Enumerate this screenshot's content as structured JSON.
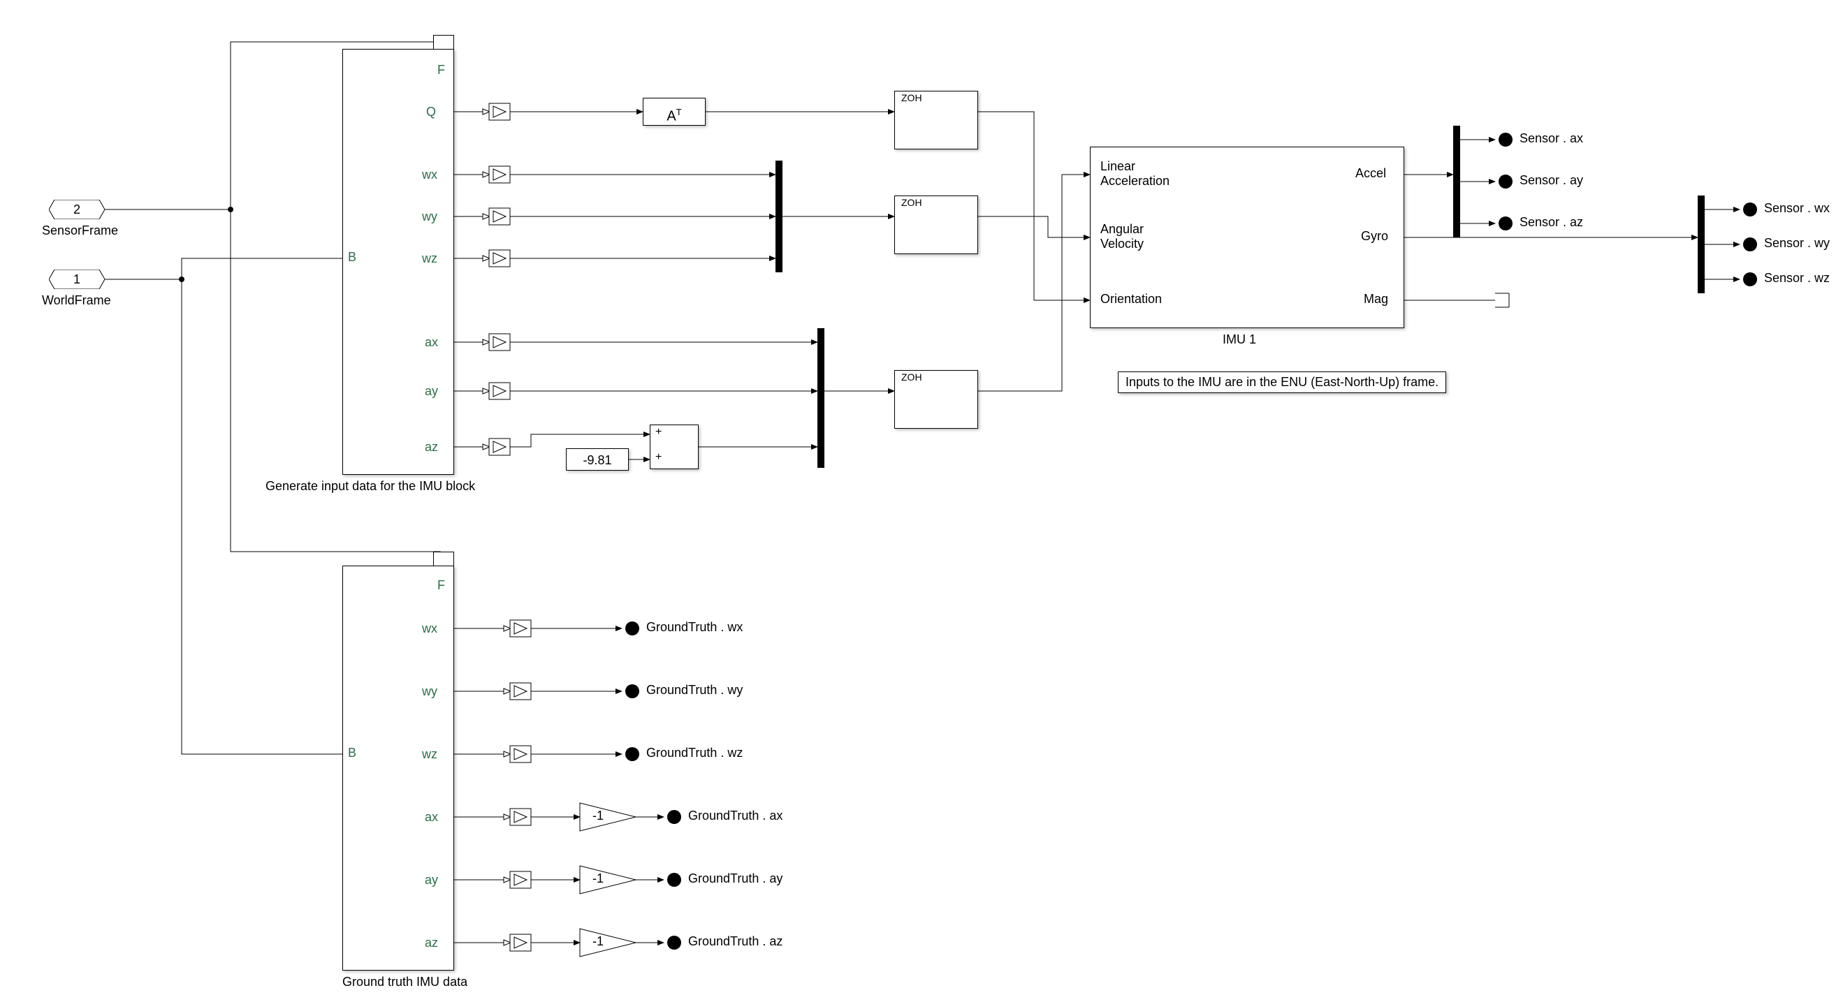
{
  "inports": {
    "in1": {
      "number": "1",
      "name": "WorldFrame"
    },
    "in2": {
      "number": "2",
      "name": "SensorFrame"
    }
  },
  "transform_block_title": "Generate input data for the IMU block",
  "transform_ports": {
    "F": "F",
    "B": "B",
    "Q": "Q",
    "wx": "wx",
    "wy": "wy",
    "wz": "wz",
    "ax": "ax",
    "ay": "ay",
    "az": "az"
  },
  "groundtruth_block_title": "Ground truth IMU data",
  "groundtruth_ports": {
    "F": "F",
    "B": "B",
    "wx": "wx",
    "wy": "wy",
    "wz": "wz",
    "ax": "ax",
    "ay": "ay",
    "az": "az"
  },
  "at_block": "A",
  "at_super": "T",
  "const_gravity": "-9.81",
  "gain_neg1": "-1",
  "sum_plus": "+",
  "zoh_label": "ZOH",
  "imu": {
    "title": "IMU 1",
    "in_linaccel": "Linear\nAcceleration",
    "in_angvel": "Angular\nVelocity",
    "in_orient": "Orientation",
    "out_accel": "Accel",
    "out_gyro": "Gyro",
    "out_mag": "Mag"
  },
  "annotation_enu": "Inputs to the IMU are in the ENU (East-North-Up) frame.",
  "goto_sensor": {
    "ax": "Sensor . ax",
    "ay": "Sensor . ay",
    "az": "Sensor . az",
    "wx": "Sensor . wx",
    "wy": "Sensor . wy",
    "wz": "Sensor . wz"
  },
  "goto_groundtruth": {
    "wx": "GroundTruth . wx",
    "wy": "GroundTruth . wy",
    "wz": "GroundTruth . wz",
    "ax": "GroundTruth . ax",
    "ay": "GroundTruth . ay",
    "az": "GroundTruth . az"
  }
}
